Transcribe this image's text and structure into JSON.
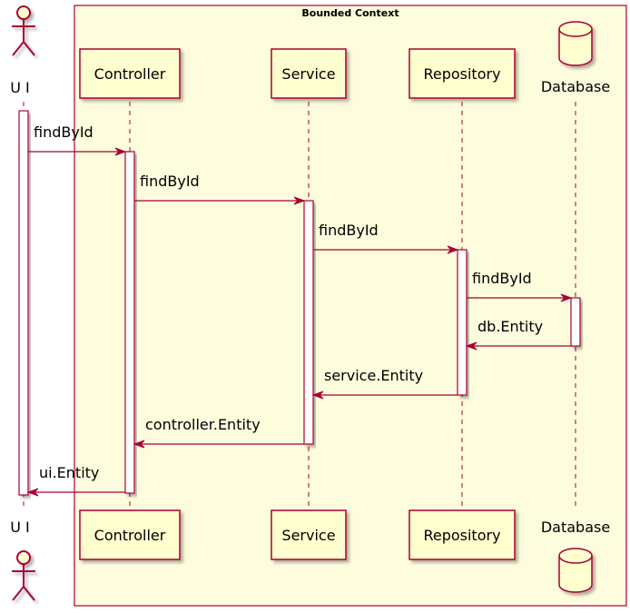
{
  "diagram": {
    "type": "sequence",
    "boundary": {
      "title": "Bounded Context"
    },
    "colors": {
      "line": "#A80036",
      "participant_fill": "#FEFECE",
      "boundary_fill": "#FDFCDC",
      "activation_fill": "#FFFFFF",
      "text": "#000000"
    },
    "participants": [
      {
        "id": "ui",
        "label": "U I",
        "kind": "actor"
      },
      {
        "id": "controller",
        "label": "Controller",
        "kind": "participant"
      },
      {
        "id": "service",
        "label": "Service",
        "kind": "participant"
      },
      {
        "id": "repository",
        "label": "Repository",
        "kind": "participant"
      },
      {
        "id": "database",
        "label": "Database",
        "kind": "database"
      }
    ],
    "messages": [
      {
        "from": "ui",
        "to": "controller",
        "label": "findById",
        "kind": "call"
      },
      {
        "from": "controller",
        "to": "service",
        "label": "findById",
        "kind": "call"
      },
      {
        "from": "service",
        "to": "repository",
        "label": "findById",
        "kind": "call"
      },
      {
        "from": "repository",
        "to": "database",
        "label": "findById",
        "kind": "call"
      },
      {
        "from": "database",
        "to": "repository",
        "label": "db.Entity",
        "kind": "return"
      },
      {
        "from": "repository",
        "to": "service",
        "label": "service.Entity",
        "kind": "return"
      },
      {
        "from": "service",
        "to": "controller",
        "label": "controller.Entity",
        "kind": "return"
      },
      {
        "from": "controller",
        "to": "ui",
        "label": "ui.Entity",
        "kind": "return"
      }
    ]
  }
}
